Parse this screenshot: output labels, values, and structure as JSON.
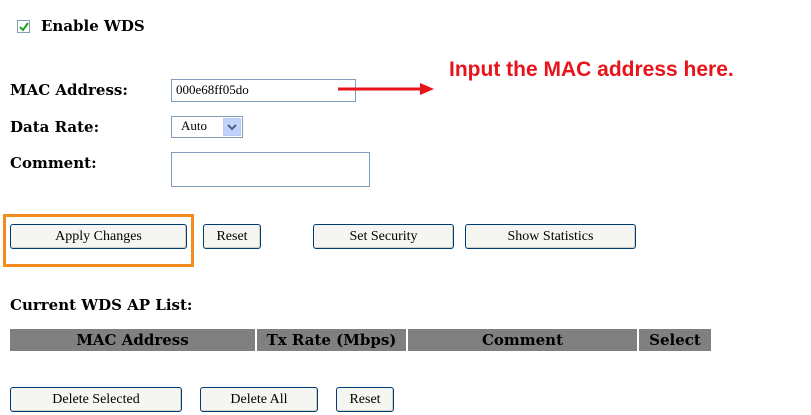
{
  "wds": {
    "enable_label": "Enable WDS",
    "enabled": true
  },
  "form": {
    "mac_label": "MAC Address:",
    "mac_value": "000e68ff05do",
    "rate_label": "Data Rate:",
    "rate_selected": "Auto",
    "comment_label": "Comment:",
    "comment_value": ""
  },
  "annotation": {
    "text": "Input the MAC address here."
  },
  "buttons": {
    "apply": "Apply Changes",
    "reset": "Reset",
    "set_security": "Set Security",
    "show_statistics": "Show Statistics"
  },
  "list": {
    "title": "Current WDS AP List:",
    "headers": [
      "MAC Address",
      "Tx Rate (Mbps)",
      "Comment",
      "Select"
    ],
    "header_bg": "#808080"
  },
  "bottom_buttons": {
    "delete_selected": "Delete Selected",
    "delete_all": "Delete All",
    "reset": "Reset"
  },
  "colors": {
    "annotation": "#e8131b",
    "highlight": "#f28c1e"
  }
}
